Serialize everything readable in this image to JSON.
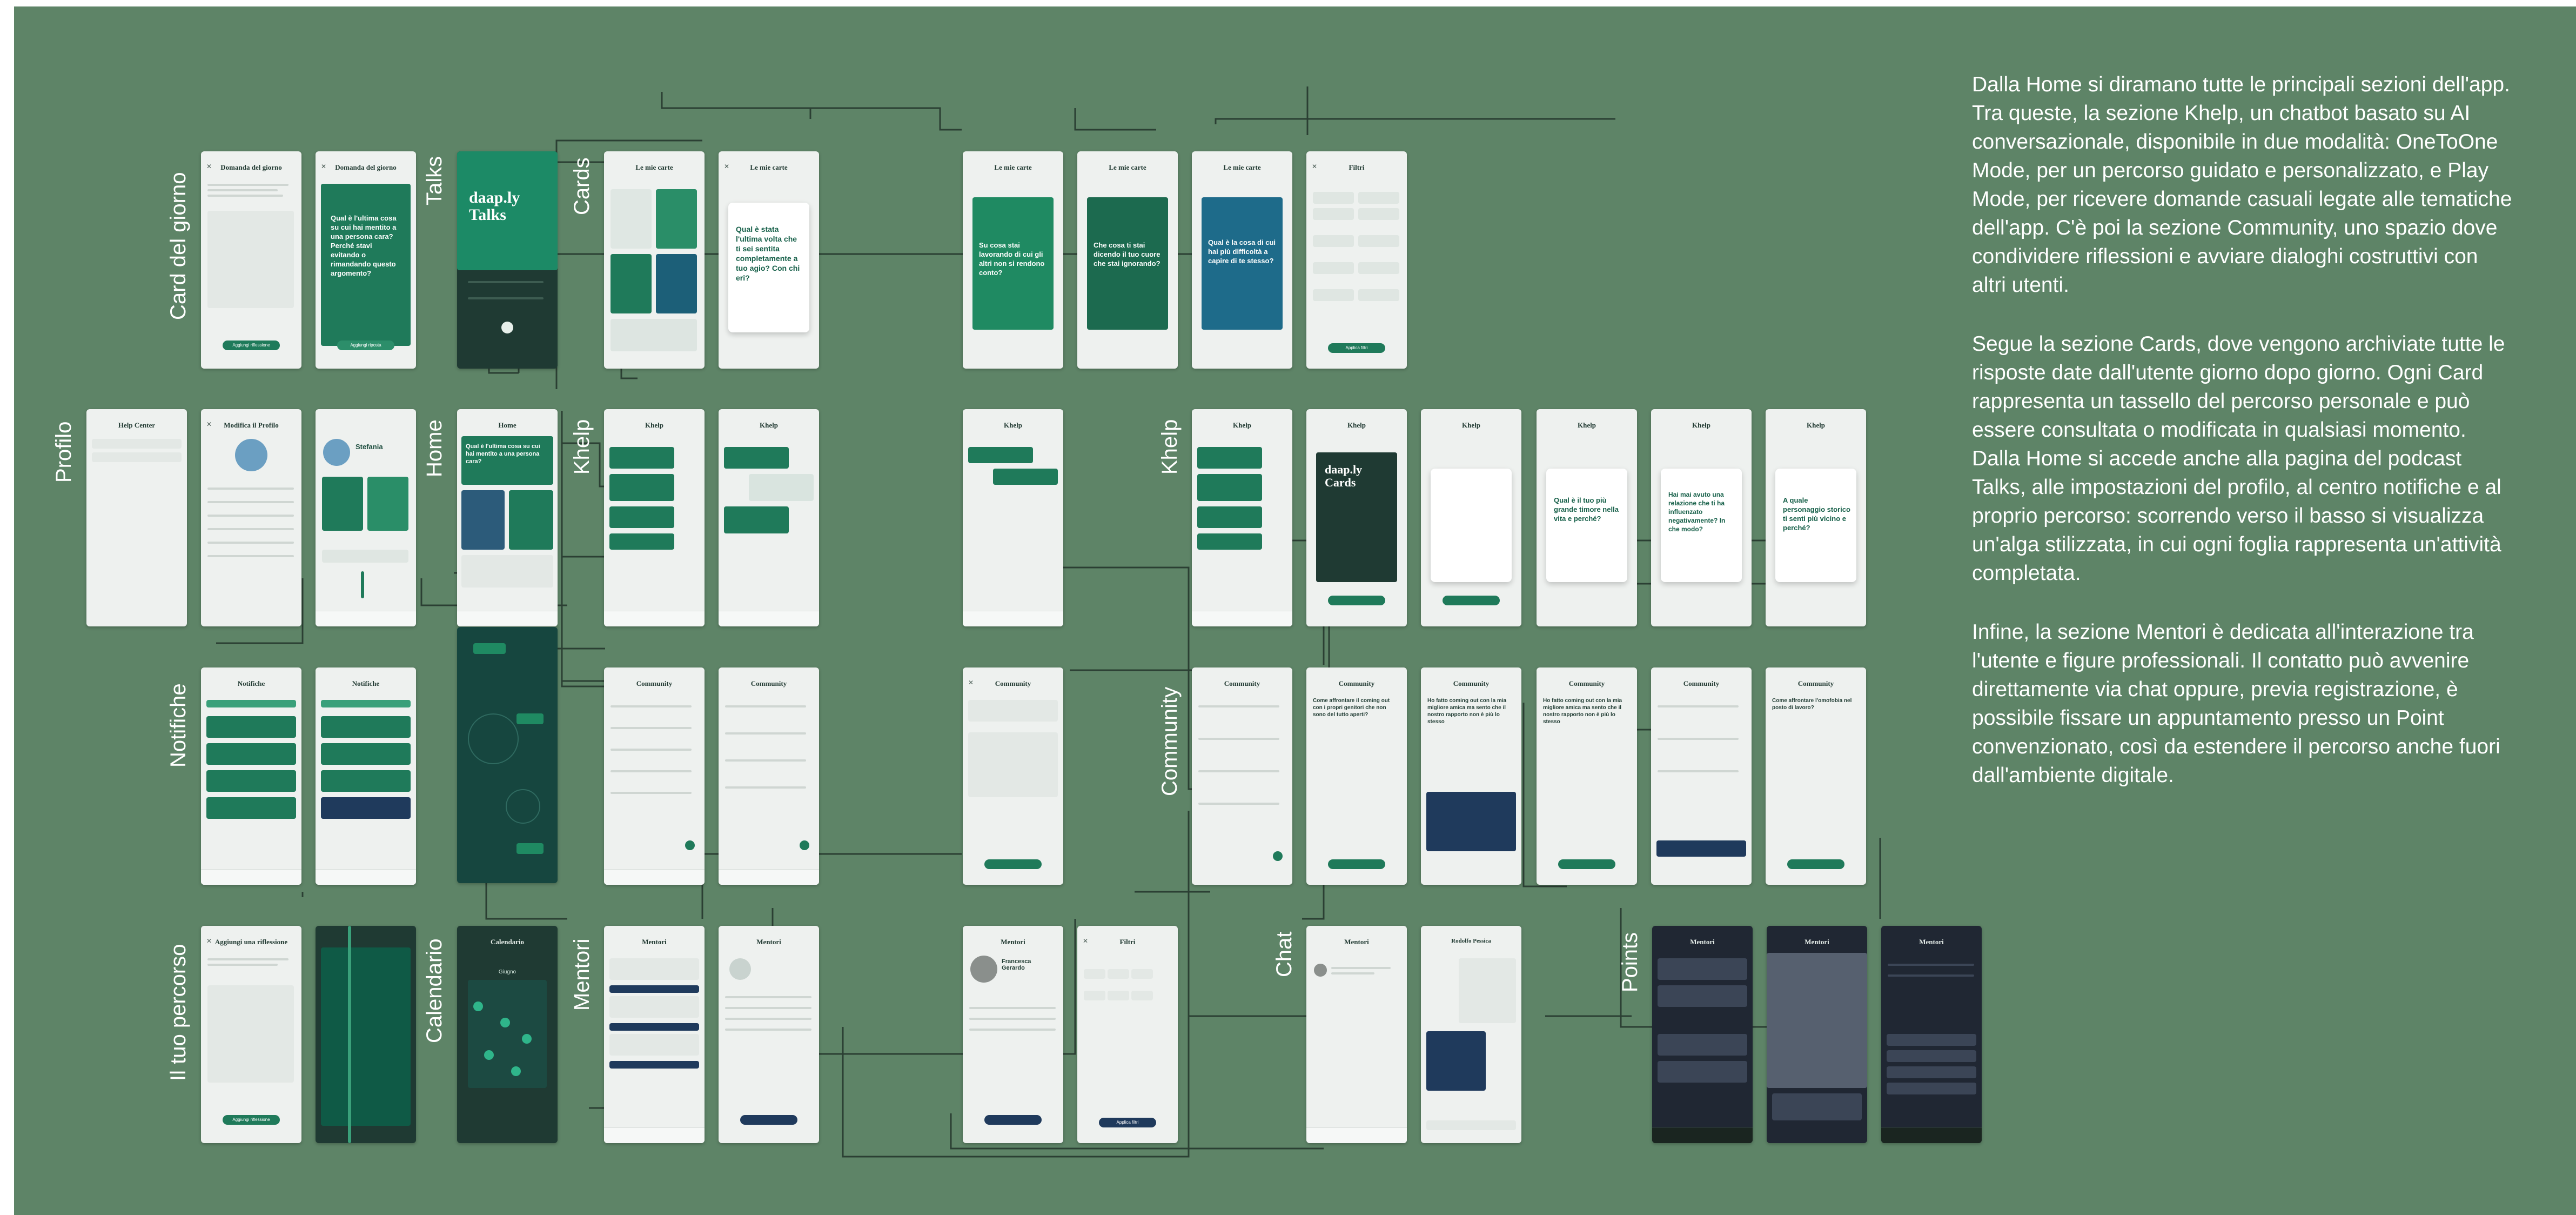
{
  "section_labels": {
    "profilo": "Profilo",
    "card_del_giorno": "Card del giorno",
    "talks": "Talks",
    "cards": "Cards",
    "home": "Home",
    "khelp_left": "Khelp",
    "khelp_right": "Khelp",
    "notifiche": "Notifiche",
    "community": "Community",
    "il_tuo_percorso": "Il tuo percorso",
    "calendario": "Calendario",
    "mentori": "Mentori",
    "chat": "Chat",
    "points": "Points"
  },
  "description": [
    "Dalla Home si diramano tutte le principali sezioni dell'app. Tra queste, la sezione Khelp, un chatbot basato su AI conversazionale, disponibile in due modalità: OneToOne Mode, per un percorso guidato e personalizzato, e Play Mode, per ricevere domande casuali legate alle tematiche dell'app. C'è poi la sezione Community, uno spazio dove condividere riflessioni e avviare dialoghi costruttivi con altri utenti.",
    "Segue la sezione Cards, dove vengono archiviate tutte le risposte date dall'utente giorno dopo giorno. Ogni Card rappresenta un tassello del percorso personale e può essere consultata o modificata in qualsiasi momento. Dalla Home si accede anche alla pagina del podcast Talks, alle impostazioni del profilo, al centro notifiche e al proprio percorso: scorrendo verso il basso si visualizza un'alga stilizzata, in cui ogni foglia rappresenta un'attività completata.",
    "Infine, la sezione Mentori è dedicata all'interazione tra l'utente e figure professionali. Il contatto può avvenire direttamente via chat oppure, previa registrazione, è possibile fissare un appuntamento presso un Point convenzionato, così da estendere il percorso anche fuori dall'ambiente digitale."
  ],
  "screens": {
    "card_giorno_1": {
      "title": "Domanda del giorno",
      "button": "Aggiungi riflessione"
    },
    "card_giorno_2": {
      "title": "Domanda del giorno",
      "question": "Qual è l'ultima cosa su cui hai mentito a una persona cara? Perché stavi evitando o rimandando questo argomento?",
      "button": "Aggiungi riposta"
    },
    "talks": {
      "logo": "daap.ly Talks"
    },
    "cards_list": {
      "title": "Le mie carte"
    },
    "cards_open": {
      "title": "Le mie carte",
      "question": "Qual è stata l'ultima volta che ti sei sentita completamente a tuo agio? Con chi eri?"
    },
    "carousel_1": {
      "title": "Le mie carte",
      "question": "Su cosa stai lavorando di cui gli altri non si rendono conto?"
    },
    "carousel_2": {
      "title": "Le mie carte",
      "question": "Che cosa ti stai dicendo il tuo cuore che stai ignorando?"
    },
    "carousel_3": {
      "title": "Le mie carte",
      "question": "Qual è la cosa di cui hai più difficoltà a capire di te stesso?"
    },
    "filtri_cards": {
      "title": "Filtri",
      "button": "Applica filtri"
    },
    "help_center": {
      "title": "Help Center"
    },
    "profilo_modifica": {
      "title": "Modifica il Profilo"
    },
    "profilo": {
      "name": "Stefania"
    },
    "home": {
      "title": "Home",
      "question": "Qual è l'ultima cosa su cui hai mentito a una persona cara?"
    },
    "khelp_1": {
      "title": "Khelp"
    },
    "khelp_2": {
      "title": "Khelp"
    },
    "khelp_3": {
      "title": "Khelp"
    },
    "khelp_play_1": {
      "title": "Khelp"
    },
    "khelp_play_2": {
      "title": "Khelp",
      "logo": "daap.ly Cards"
    },
    "khelp_play_3": {
      "title": "Khelp"
    },
    "khelp_play_4": {
      "title": "Khelp",
      "question": "Qual è il tuo più grande timore nella vita e perché?"
    },
    "khelp_play_5": {
      "title": "Khelp",
      "question": "Hai mai avuto una relazione che ti ha influenzato negativamente? In che modo?"
    },
    "khelp_play_6": {
      "title": "Khelp",
      "question": "A quale personaggio storico ti senti più vicino e perché?"
    },
    "notifiche_1": {
      "title": "Notifiche"
    },
    "notifiche_2": {
      "title": "Notifiche"
    },
    "community_1": {
      "title": "Community"
    },
    "community_2": {
      "title": "Community"
    },
    "community_3": {
      "title": "Community"
    },
    "community_r1": {
      "title": "Community"
    },
    "community_r2": {
      "title": "Community",
      "question": "Come affrontare il coming out con i propri genitori che non sono del tutto aperti?"
    },
    "community_r3": {
      "title": "Community",
      "question": "Ho fatto coming out con la mia migliore amica ma sento che il nostro rapporto non è più lo stesso"
    },
    "community_r4": {
      "title": "Community",
      "question": "Ho fatto coming out con la mia migliore amica ma sento che il nostro rapporto non è più lo stesso"
    },
    "community_r5": {
      "title": "Community"
    },
    "community_r6": {
      "title": "Community",
      "question": "Come affrontare l'omofobia nel posto di lavoro?"
    },
    "percorso_1": {
      "title": "Aggiungi una riflessione",
      "button": "Aggiungi riflessione"
    },
    "calendario": {
      "title": "Calendario",
      "month": "Giugno"
    },
    "mentori_1": {
      "title": "Mentori"
    },
    "mentori_2": {
      "title": "Mentori"
    },
    "mentori_3": {
      "title": "Mentori",
      "name": "Francesca Gerardo"
    },
    "filtri_mentori": {
      "title": "Filtri",
      "button": "Applica filtri"
    },
    "chat_1": {
      "title": "Mentori"
    },
    "chat_2": {
      "title": "Rodolfo Pessica"
    },
    "points_1": {
      "title": "Mentori"
    },
    "points_2": {
      "title": "Mentori"
    },
    "points_3": {
      "title": "Mentori"
    }
  },
  "colors": {
    "panel": "#5e8467",
    "screen": "#eef1ef",
    "accent": "#1f7a5a",
    "dark": "#1f3a33",
    "navy": "#202733",
    "wire": "#2b3f33"
  }
}
